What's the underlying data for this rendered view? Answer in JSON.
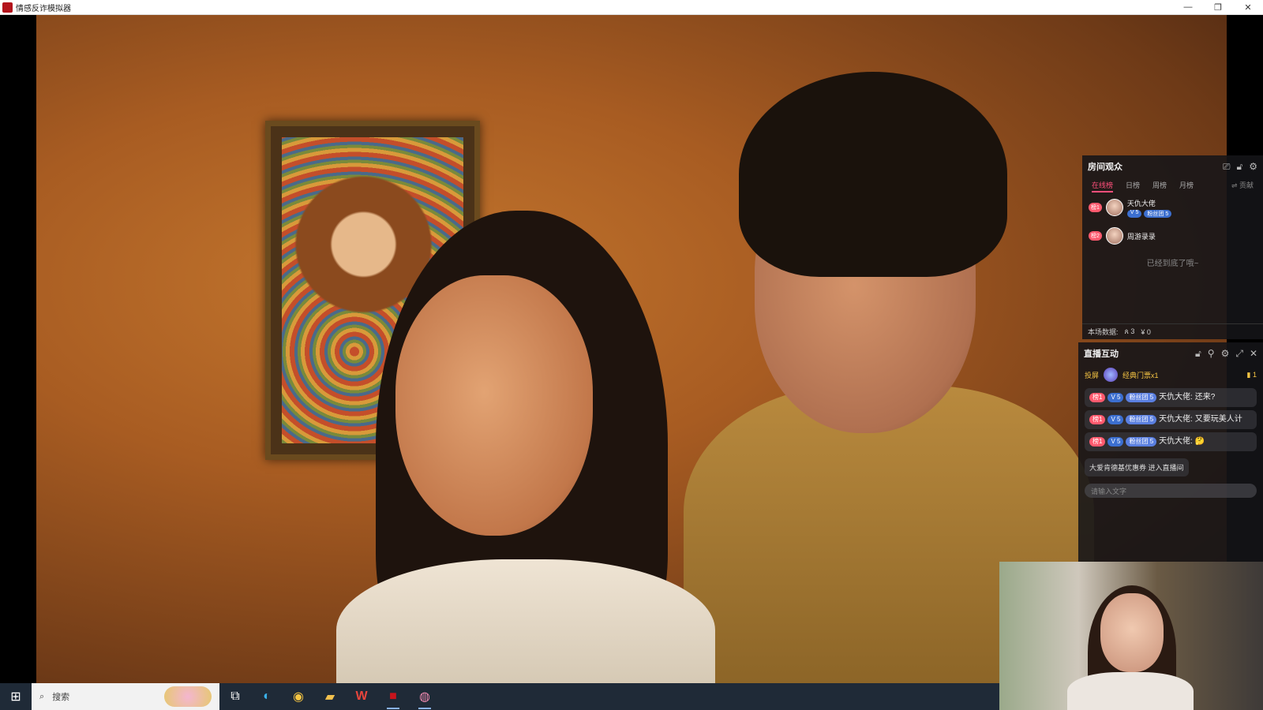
{
  "window": {
    "title": "情感反诈模拟器",
    "minimize": "—",
    "restore": "❐",
    "close": "✕"
  },
  "audience_panel": {
    "title": "房间观众",
    "icons": [
      "delete-icon",
      "lock-icon",
      "settings-icon"
    ],
    "tabs": [
      "在线榜",
      "日榜",
      "周榜",
      "月榜"
    ],
    "active_tab": "在线榜",
    "contrib_label": "⇌ 贡献",
    "viewers": [
      {
        "rank": "榜1",
        "name": "天仇大佬",
        "level": "V 5",
        "fan": "粉丝团 5"
      },
      {
        "rank": "榜2",
        "name": "周游录录"
      }
    ],
    "end_note": "已经到底了哦~",
    "stats": {
      "label": "本场数据:",
      "viewers": "ጰ 3",
      "revenue": "¥ 0"
    }
  },
  "interaction_panel": {
    "title": "直播互动",
    "icons": [
      "lock-icon",
      "pin-icon",
      "settings-icon",
      "expand-icon",
      "close-icon"
    ],
    "gift": {
      "prefix": "投屏",
      "name": "经典门票x1",
      "count": "1"
    },
    "messages": [
      {
        "badges": [
          "榜1",
          "V 5",
          "粉丝团 5"
        ],
        "text": "天仇大佬: 还来?"
      },
      {
        "badges": [
          "榜1",
          "V 5",
          "粉丝团 5"
        ],
        "text": "天仇大佬: 又要玩美人计"
      },
      {
        "badges": [
          "榜1",
          "V 5",
          "粉丝团 5"
        ],
        "text": "天仇大佬: 🤔"
      }
    ],
    "enter_notice": "大爱肯德基优惠券 进入直播间",
    "input_placeholder": "请输入文字"
  },
  "taskbar": {
    "start_icon": "windows-icon",
    "search_placeholder": "搜索",
    "apps": [
      {
        "name": "task-view-icon",
        "glyph": "⧉"
      },
      {
        "name": "edge-icon",
        "glyph": "◐"
      },
      {
        "name": "browser-icon",
        "glyph": "◉"
      },
      {
        "name": "file-explorer-icon",
        "glyph": "▰"
      },
      {
        "name": "wps-icon",
        "glyph": "W"
      },
      {
        "name": "game-app-icon",
        "glyph": "■"
      },
      {
        "name": "live-app-icon",
        "glyph": "◍"
      }
    ]
  },
  "colors": {
    "accent_pink": "#ff4f7b",
    "rank_badge": "#ff5a6e",
    "gift_gold": "#f6c543",
    "taskbar_bg": "#1f2a37"
  }
}
